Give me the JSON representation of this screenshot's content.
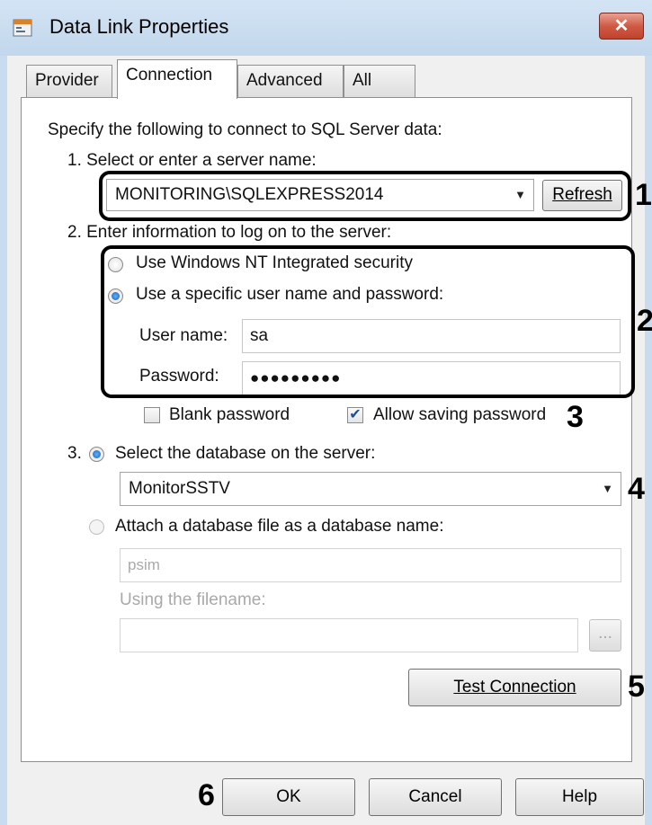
{
  "window": {
    "title": "Data Link Properties",
    "close_label": "✕"
  },
  "tabs": [
    {
      "label": "Provider"
    },
    {
      "label": "Connection"
    },
    {
      "label": "Advanced"
    },
    {
      "label": "All"
    }
  ],
  "connection": {
    "intro": "Specify the following to connect to SQL Server data:",
    "step1_label": "1. Select or enter a server name:",
    "server_value": "MONITORING\\SQLEXPRESS2014",
    "refresh_label": "Refresh",
    "step2_label": "2. Enter information to log on to the server:",
    "radio_nt_label": "Use Windows NT Integrated security",
    "radio_specific_label": "Use a specific user name and password:",
    "username_label": "User name:",
    "username_value": "sa",
    "password_label": "Password:",
    "password_value": "●●●●●●●●●",
    "blank_password_label": "Blank password",
    "allow_saving_label": "Allow saving password",
    "step3_prefix": "3.",
    "select_db_label": "Select the database on the server:",
    "database_value": "MonitorSSTV",
    "attach_label": "Attach a database file as a database name:",
    "attach_name_value": "psim",
    "filename_label": "Using the filename:",
    "filename_value": "",
    "browse_label": "...",
    "test_label": "Test Connection"
  },
  "footer": {
    "ok_label": "OK",
    "cancel_label": "Cancel",
    "help_label": "Help"
  },
  "callouts": [
    "1",
    "2",
    "3",
    "4",
    "5",
    "6"
  ],
  "state": {
    "radio_nt_checked": false,
    "radio_specific_checked": true,
    "blank_password_checked": false,
    "allow_saving_checked": true,
    "select_db_checked": true,
    "attach_checked": false
  }
}
